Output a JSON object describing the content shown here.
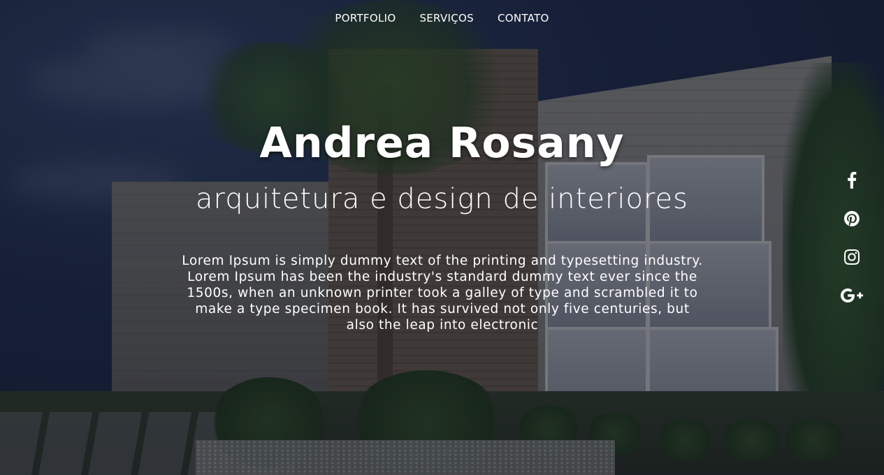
{
  "nav": {
    "items": [
      {
        "label": "PORTFOLIO"
      },
      {
        "label": "SERVIÇOS"
      },
      {
        "label": "CONTATO"
      }
    ]
  },
  "hero": {
    "title": "Andrea Rosany",
    "subtitle": "arquitetura e design de interiores",
    "description": "Lorem Ipsum is simply dummy text of the printing and typesetting industry. Lorem Ipsum has been the industry's standard dummy text ever since the 1500s, when an unknown printer took a galley of type and scrambled it to make a type specimen book. It has survived not only five centuries, but also the leap into electronic"
  },
  "social": {
    "icons": [
      "facebook-icon",
      "pinterest-icon",
      "instagram-icon",
      "google-plus-icon"
    ]
  },
  "colors": {
    "text": "#ffffff",
    "overlay": "#0a0e18"
  }
}
